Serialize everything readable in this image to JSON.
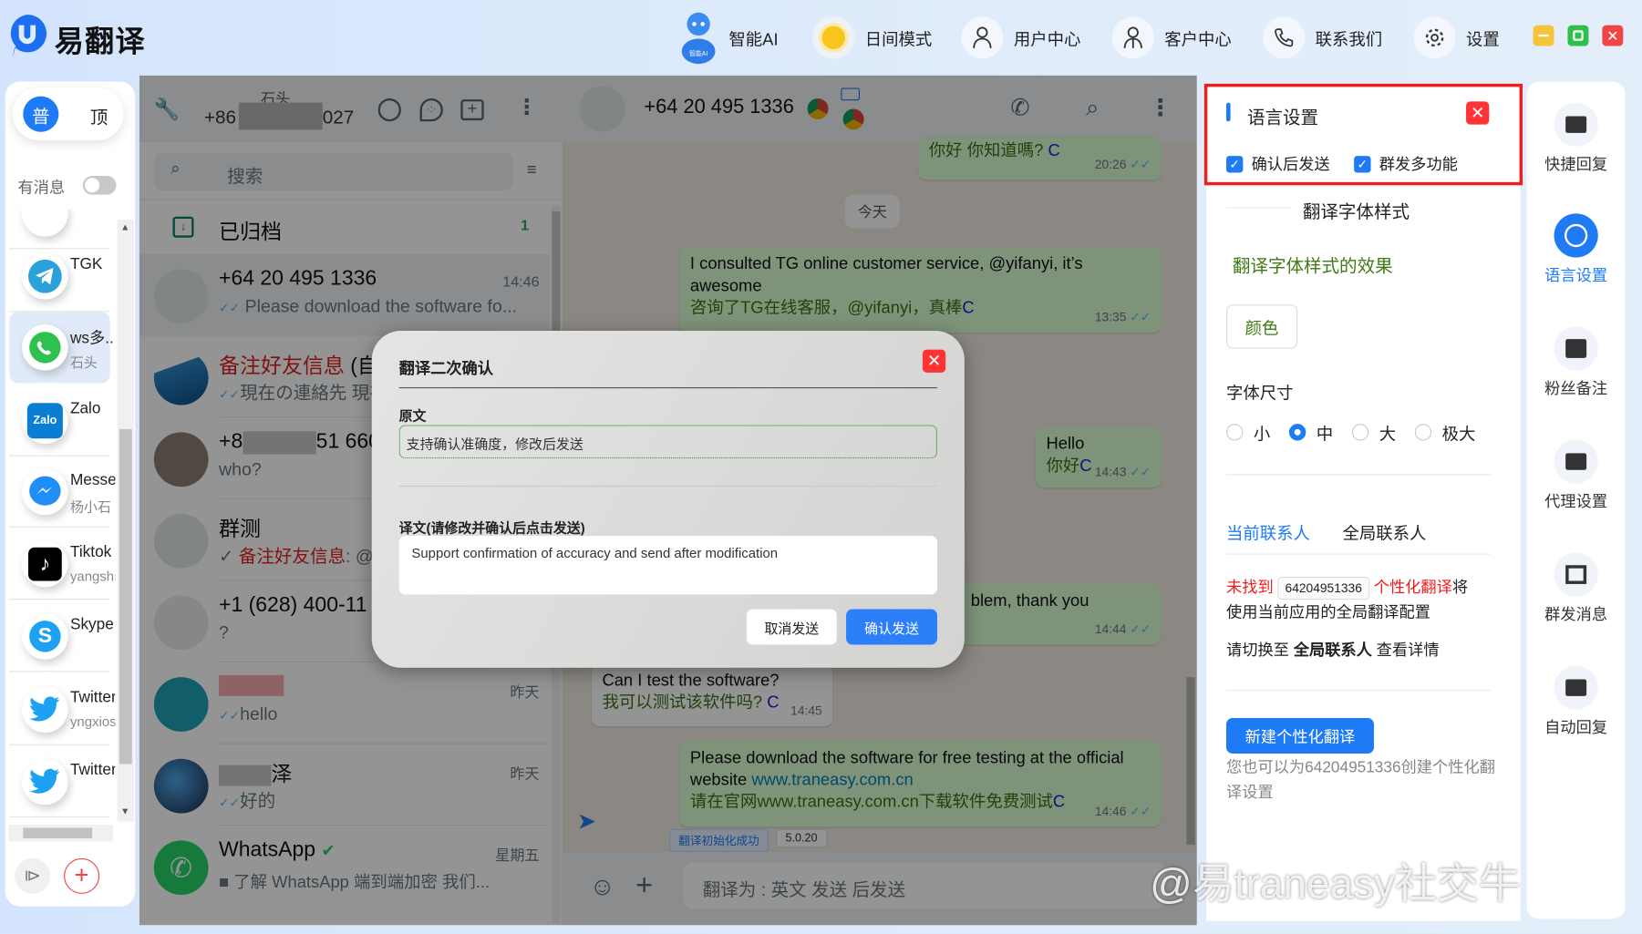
{
  "app": {
    "name": "易翻译"
  },
  "topnav": {
    "ai": "智能AI",
    "daymode": "日间模式",
    "user_center": "用户中心",
    "customer_center": "客户中心",
    "contact_us": "联系我们",
    "settings": "设置",
    "colors": {
      "minimize": "#f5c43a",
      "maximize": "#2fc04a",
      "close": "#f04545"
    }
  },
  "appbar": {
    "pill_on": "普",
    "pill_off": "顶",
    "has_message_label": "有消息",
    "has_message_enabled": false,
    "apps": [
      {
        "name": "TGK",
        "sub": "",
        "icon": "telegram-icon"
      },
      {
        "name": "ws多...",
        "sub": "石头",
        "icon": "whatsapp-icon",
        "active": true
      },
      {
        "name": "Zalo",
        "sub": "",
        "icon": "zalo-icon"
      },
      {
        "name": "Messe.",
        "sub": "杨小石",
        "icon": "messenger-icon"
      },
      {
        "name": "Tiktok",
        "sub": "yangshi.",
        "icon": "tiktok-icon"
      },
      {
        "name": "Skype",
        "sub": "",
        "icon": "skype-icon"
      },
      {
        "name": "Twitter",
        "sub": "yngxios.",
        "icon": "twitter-icon"
      },
      {
        "name": "Twitter",
        "sub": "",
        "icon": "twitter-icon"
      }
    ]
  },
  "chatlist": {
    "profile_name": "石头",
    "profile_phone_start": "+86",
    "profile_phone_end": "027",
    "search_placeholder": "搜索",
    "archived_label": "已归档",
    "archived_count": "1",
    "rows": [
      {
        "name": "+64 20 495 1336",
        "msg": "Please download the software fo...",
        "time": "14:46",
        "ticks": true
      },
      {
        "name": "备注好友信息",
        "name_suffix": " (自",
        "msg": "現在の連絡先 現在",
        "time": "",
        "ticks": true
      },
      {
        "name": "+8",
        "name_suffix": "51 660",
        "msg": "who?",
        "time": ""
      },
      {
        "name": "群测",
        "msg_red": "备注好友信息",
        "msg": ": @",
        "time": "",
        "single_tick": true
      },
      {
        "name": "+1 (628) 400-11",
        "msg": "?",
        "time": ""
      },
      {
        "name": "",
        "msg": "hello",
        "time": "昨天",
        "ticks": true
      },
      {
        "name": "泽",
        "msg": "好的",
        "time": "昨天",
        "ticks": true
      },
      {
        "name": "WhatsApp",
        "msg": "了解 WhatsApp 端到端加密  我们...",
        "time": "星期五",
        "verified": true
      }
    ]
  },
  "chat": {
    "contact": "+64 20 495 1336",
    "date_divider": "今天",
    "messages": [
      {
        "dir": "out",
        "text": "",
        "translation": "你好 你知道嗎?",
        "time": "20:26"
      },
      {
        "dir": "out",
        "text": "I consulted TG online customer service, @yifanyi, it’s awesome",
        "translation": "咨询了TG在线客服，@yifanyi，真棒",
        "time": "13:35"
      },
      {
        "dir": "out",
        "text": "Hello",
        "translation": "你好",
        "time": "14:43"
      },
      {
        "dir": "out",
        "text": "blem, thank you",
        "translation": "",
        "time": "14:44"
      },
      {
        "dir": "in",
        "text": "Can I test the software?",
        "translation": "我可以测试该软件吗?",
        "time": "14:45"
      },
      {
        "dir": "out",
        "text": "Please download the software for free testing at the official website ",
        "link": "www.traneasy.com.cn",
        "translation": "请在官网www.traneasy.com.cn下载软件免费测试",
        "time": "14:46"
      }
    ],
    "status_badge": "翻译初始化成功",
    "version_badge": "5.0.20",
    "composer_placeholder": "翻译为 : 英文 发送 后发送"
  },
  "modal": {
    "title": "翻译二次确认",
    "source_label": "原文",
    "source_text": "支持确认准确度，修改后发送",
    "target_label": "译文(请修改并确认后点击发送)",
    "target_text": "Support confirmation of accuracy and send after modification",
    "cancel": "取消发送",
    "confirm": "确认发送"
  },
  "settings": {
    "section_title": "语言设置",
    "confirm_send": "确认后发送",
    "confirm_send_checked": true,
    "group_send": "群发多功能",
    "group_send_checked": true,
    "font_style_title": "翻译字体样式",
    "font_style_preview": "翻译字体样式的效果",
    "color_button": "颜色",
    "font_size_label": "字体尺寸",
    "font_sizes": [
      "小",
      "中",
      "大",
      "极大"
    ],
    "font_size_selected": "中",
    "tab_current": "当前联系人",
    "tab_global": "全局联系人",
    "not_found": "未找到",
    "contact_number": "64204951336",
    "personal_translation": "个性化翻译",
    "will": "将",
    "use_global": "使用当前应用的全局翻译配置",
    "switch_prefix": "请切换至 ",
    "switch_bold": "全局联系人",
    "switch_suffix": " 查看详情",
    "new_button": "新建个性化翻译",
    "hint": "您也可以为64204951336创建个性化翻译设置"
  },
  "tools": [
    {
      "label": "快捷回复",
      "icon": "quick-reply-icon"
    },
    {
      "label": "语言设置",
      "icon": "globe-icon",
      "active": true
    },
    {
      "label": "粉丝备注",
      "icon": "notes-icon"
    },
    {
      "label": "代理设置",
      "icon": "proxy-icon"
    },
    {
      "label": "群发消息",
      "icon": "broadcast-icon"
    },
    {
      "label": "自动回复",
      "icon": "auto-reply-icon"
    }
  ],
  "watermark": "@易traneasy社交牛"
}
